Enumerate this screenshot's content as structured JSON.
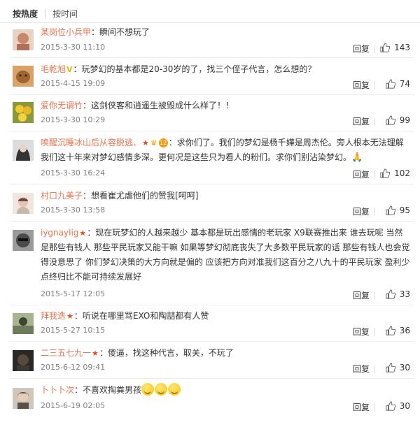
{
  "tabs": {
    "hot": "按热度",
    "time": "按时间"
  },
  "comments": [
    {
      "user": "某岗位小兵甲",
      "badges": [],
      "text": "：瞬间不想玩了",
      "time": "2015-3-30 11:10",
      "reply": "回复",
      "likes": "143",
      "avatar": "#c58a6e"
    },
    {
      "user": "毛乾旭",
      "badges": [
        "V"
      ],
      "text": "：玩梦幻的基本都是20-30岁的了，找三个侄子代言，怎么想的？",
      "time": "2015-4-15 19:09",
      "reply": "回复",
      "likes": "74",
      "avatar": "#a0652c"
    },
    {
      "user": "爱你无谓竹",
      "badges": [],
      "text": "：这剑侠客和逍遥生被毁成什么样了！！",
      "time": "2015-3-30 10:29",
      "reply": "回复",
      "likes": "99",
      "avatar": "#d9b63a"
    },
    {
      "user": "唤醒沉睡冰山后从容脱逃、",
      "badges": [
        "★",
        "♛",
        "12"
      ],
      "text": "：求你们了。我们的梦幻是杨千嬅是周杰伦。旁人根本无法理解我们这十年来对梦幻感情多深。更何况是这些只为看人的粉们。求你们别沾染梦幻。",
      "time": "2015-3-30 16:24",
      "reply": "回复",
      "likes": "102",
      "avatar": "#7a7a7a"
    },
    {
      "user": "村口九美子",
      "badges": [],
      "text": "：想看崔尤虐他们的赞我[呵呵]",
      "time": "2015-3-30 13:58",
      "reply": "回复",
      "likes": "95",
      "avatar": "#c7b8a8"
    },
    {
      "user": "iygnaylig",
      "badges": [
        "★"
      ],
      "text": "：现在玩梦幻的人越来越少 基本都是玩出感情的老玩家  X9联赛推出来 谁去玩呢 当然是那些有钱人 那些平民玩家又能干嘛 如果等梦幻彻底丧失了大多数平民玩家的话 那些有钱人也会觉得没意思了 你们梦幻决策的大方向就是偏的 应该把方向对准我们这百分之八九十的平民玩家 盈利少点终归比不能可持续发展好",
      "time": "2015-5-17 12:05",
      "reply": "回复",
      "likes": "33",
      "avatar": "#4a4a4a"
    },
    {
      "user": "拜我迭",
      "badges": [
        "★"
      ],
      "text": "：听说在哪里骂EXO和陶喆都有人赞",
      "time": "2015-5-27 10:15",
      "reply": "回复",
      "likes": "36",
      "avatar": "#6e7b5b"
    },
    {
      "user": "二三五七九一",
      "badges": [
        "★"
      ],
      "text": "：傻逼，找这种代言，取关，不玩了",
      "time": "2015-6-12 09:41",
      "reply": "回复",
      "likes": "30",
      "avatar": "#3d3a36"
    },
    {
      "user": "卜卜卜次",
      "badges": [],
      "text": "：不喜欢掏粪男孩",
      "time": "2015-6-19 02:05",
      "reply": "回复",
      "likes": "30",
      "avatar": "#5a5048"
    }
  ]
}
